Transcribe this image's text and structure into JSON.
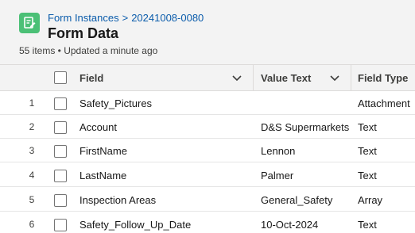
{
  "header": {
    "breadcrumb": {
      "parent": "Form Instances",
      "separator": ">",
      "record": "20241008-0080"
    },
    "title": "Form Data",
    "meta": "55 items • Updated a minute ago",
    "icon": "form-icon",
    "icon_color": "#4bc076"
  },
  "table": {
    "columns": [
      {
        "label": "Field"
      },
      {
        "label": "Value Text"
      },
      {
        "label": "Field Type"
      }
    ],
    "rows": [
      {
        "num": "1",
        "field": "Safety_Pictures",
        "value": "",
        "type": "Attachment"
      },
      {
        "num": "2",
        "field": "Account",
        "value": "D&S Supermarkets",
        "type": "Text"
      },
      {
        "num": "3",
        "field": "FirstName",
        "value": "Lennon",
        "type": "Text"
      },
      {
        "num": "4",
        "field": "LastName",
        "value": "Palmer",
        "type": "Text"
      },
      {
        "num": "5",
        "field": "Inspection Areas",
        "value": "General_Safety",
        "type": "Array"
      },
      {
        "num": "6",
        "field": "Safety_Follow_Up_Date",
        "value": "10-Oct-2024",
        "type": "Text"
      }
    ]
  }
}
